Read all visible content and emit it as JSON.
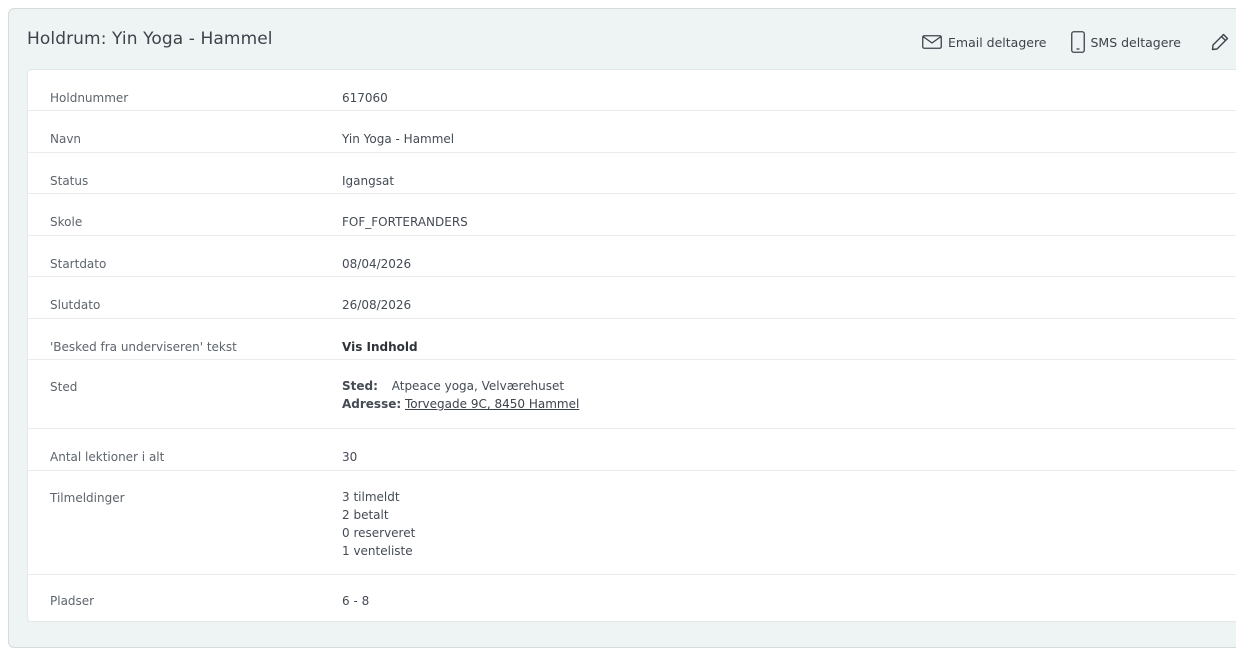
{
  "header": {
    "title": "Holdrum: Yin Yoga - Hammel",
    "email_label": "Email deltagere",
    "sms_label": "SMS deltagere"
  },
  "rows": [
    {
      "label": "Holdnummer",
      "value": "617060"
    },
    {
      "label": "Navn",
      "value": "Yin Yoga - Hammel"
    },
    {
      "label": "Status",
      "value": "Igangsat"
    },
    {
      "label": "Skole",
      "value": "FOF_FORTERANDERS"
    },
    {
      "label": "Startdato",
      "value": "08/04/2026"
    },
    {
      "label": "Slutdato",
      "value": "26/08/2026"
    },
    {
      "label": "'Besked fra underviseren' tekst",
      "value": "Vis Indhold"
    },
    {
      "label": "Sted",
      "sted_key": "Sted:",
      "sted_value": "Atpeace yoga, Velværehuset",
      "adresse_key": "Adresse:",
      "adresse_value": "Torvegade 9C, 8450 Hammel"
    },
    {
      "label": "Antal lektioner i alt",
      "value": "30"
    },
    {
      "label": "Tilmeldinger",
      "lines": [
        "3 tilmeldt",
        "2 betalt",
        "0 reserveret",
        "1 venteliste"
      ]
    },
    {
      "label": "Pladser",
      "value": "6 - 8"
    }
  ],
  "colors": {
    "panel_bg": "#eef4f4",
    "card_bg": "#ffffff",
    "text": "#444b55"
  },
  "icons": {
    "email": "envelope-icon",
    "sms": "phone-icon",
    "edit": "pencil-icon"
  }
}
